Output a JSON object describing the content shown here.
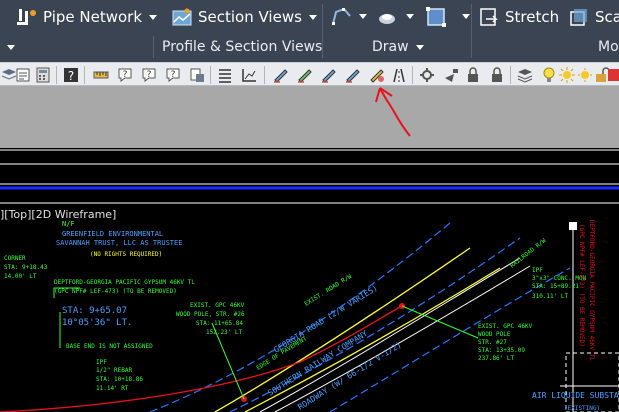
{
  "ribbon": {
    "buttons": [
      {
        "label": "Pipe Network",
        "icon": "pipe-network-icon"
      },
      {
        "label": "Section Views",
        "icon": "section-views-icon"
      },
      {
        "label": "Stretch",
        "icon": "stretch-icon"
      },
      {
        "label": "Sca",
        "icon": "scale-icon"
      }
    ],
    "panels": [
      {
        "label": "Profile & Section Views"
      },
      {
        "label": "Draw"
      },
      {
        "label": "Mo"
      }
    ]
  },
  "viewport": {
    "label": "][Top][2D Wireframe]"
  },
  "drawing_annotations": {
    "owner_top": [
      "N/F",
      "GREENFIELD ENVIRONMENTAL",
      "SAVANNAH TRUST, LLC AS TRUSTEE"
    ],
    "owner_note": "(NO RIGHTS REQUIRED)",
    "corner_left": [
      "CORNER",
      "STA: 9+18.43",
      "14.00' LT"
    ],
    "georgia_pacific": [
      "DEPTFORD-GEORGIA PACIFIC GYPSUM 46KV TL",
      "(GPC NPF# LEF-473) (TO BE REMOVED)"
    ],
    "station_main": [
      "STA: 9+65.07",
      "10°05'36\" LT."
    ],
    "base_end": "BASE END IS NOT ASSIGNED",
    "ipf": [
      "IPF",
      "1/2\" REBAR",
      "STA: 10+18.86",
      "11.14' RT"
    ],
    "exist_pole_left": [
      "EXIST. GPC 46KV",
      "WOOD POLE, STR. #26",
      "STA: 11+65.84",
      "152.23' LT"
    ],
    "exist_pole_right": [
      "EXIST. GPC 46KV",
      "WOOD POLE",
      "STR. #27",
      "STA: 13+35.09",
      "237.86' LT"
    ],
    "ipf_right": [
      "IPF",
      "3\"x3\" CONC. MON",
      "STA: 15+89.21",
      "310.11' LT"
    ],
    "railroad_rw": "RAILROAD R/W",
    "road_rw": "EXIST. ROAD R/W",
    "edge_pavement": "EDGE OF PAVEMENT",
    "georgia_road": "GEORGIA ROAD (2/W VARIES)",
    "southern_rail": "SOUTHERN RAILWAY COMPANY",
    "roadway": "ROADWAY (W/ 66-1/2 V-1/2)",
    "deptford_vertical": "DEPTFORD-GEORGIA PACIFIC GYPSUM 46KV TL",
    "gpc_vertical": "(GPC NPF# LEF-473) (TO BE REMOVED)",
    "air_liquide": "AIR LIQUIDE SUBSTATI",
    "air_liquide_sub": "(EXISTING)"
  },
  "colors": {
    "ribbon_bg": "#3b4453",
    "toolbar_bg": "#e9ebee",
    "gray_band": "#a8a8a8",
    "canvas_bg": "#000000",
    "annotation_red": "#e8121d",
    "blue_line": "#1a2cff",
    "yellow": "#ffff33",
    "green": "#33ff33",
    "cyan": "#33aaff"
  },
  "toolbar_icons": [
    "layer-icon",
    "properties-icon",
    "calculator-icon",
    "help-icon",
    "ruler-icon",
    "help-icon",
    "help-icon",
    "help-icon",
    "find-icon",
    "table-icon",
    "graph-icon",
    "edit-icon",
    "edit-icon",
    "edit-icon",
    "edit-icon",
    "edit-icon",
    "edit-icon",
    "road-icon",
    "gear-icon",
    "cursor-icon",
    "cursor-icon",
    "lock-icon",
    "lock-icon",
    "layer-icon",
    "bulb-icon",
    "sun-icon",
    "unlock-icon",
    "color-icon"
  ]
}
